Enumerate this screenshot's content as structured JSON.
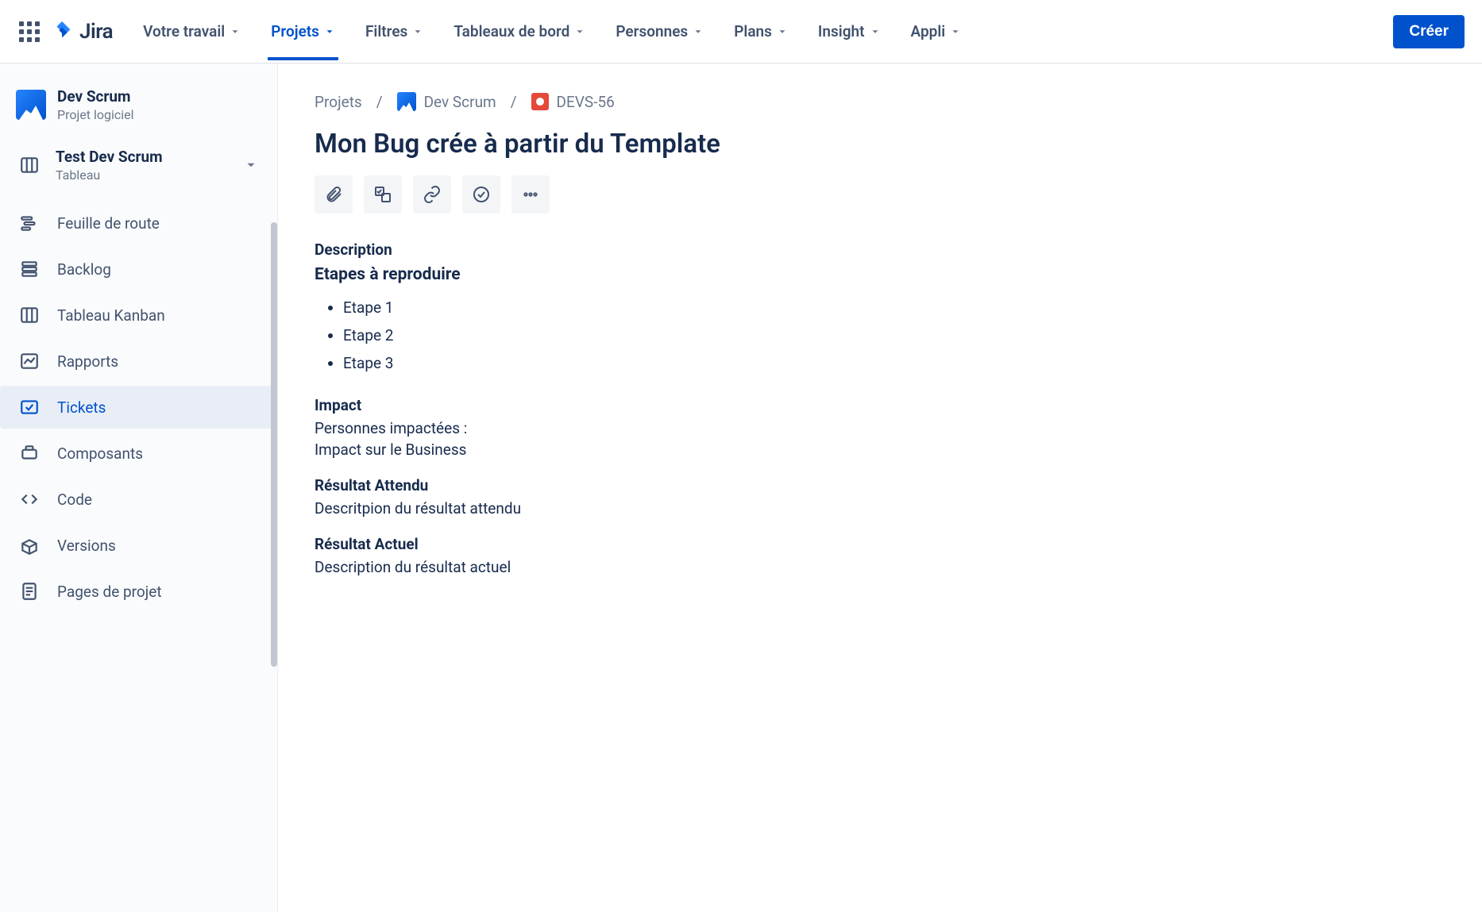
{
  "topnav": {
    "product": "Jira",
    "items": [
      {
        "label": "Votre travail",
        "active": false
      },
      {
        "label": "Projets",
        "active": true
      },
      {
        "label": "Filtres",
        "active": false
      },
      {
        "label": "Tableaux de bord",
        "active": false
      },
      {
        "label": "Personnes",
        "active": false
      },
      {
        "label": "Plans",
        "active": false
      },
      {
        "label": "Insight",
        "active": false
      },
      {
        "label": "Appli",
        "active": false
      }
    ],
    "create": "Créer"
  },
  "sidebar": {
    "project": {
      "name": "Dev Scrum",
      "type": "Projet logiciel"
    },
    "board": {
      "title": "Test Dev Scrum",
      "sub": "Tableau"
    },
    "items": [
      {
        "label": "Feuille de route",
        "icon": "roadmap"
      },
      {
        "label": "Backlog",
        "icon": "backlog"
      },
      {
        "label": "Tableau Kanban",
        "icon": "board"
      },
      {
        "label": "Rapports",
        "icon": "reports"
      },
      {
        "label": "Tickets",
        "icon": "issues",
        "selected": true
      },
      {
        "label": "Composants",
        "icon": "components"
      },
      {
        "label": "Code",
        "icon": "code"
      },
      {
        "label": "Versions",
        "icon": "versions"
      },
      {
        "label": "Pages de projet",
        "icon": "pages"
      }
    ]
  },
  "breadcrumb": {
    "root": "Projets",
    "project": "Dev Scrum",
    "issue_key": "DEVS-56"
  },
  "issue": {
    "title": "Mon Bug crée à partir du Template",
    "description_label": "Description",
    "steps_heading": "Etapes à reproduire",
    "steps": [
      "Etape 1",
      "Etape 2",
      "Etape 3"
    ],
    "impact": {
      "heading": "Impact",
      "line1": "Personnes impactées :",
      "line2": "Impact sur le Business"
    },
    "expected": {
      "heading": "Résultat Attendu",
      "body": "Descritpion du résultat attendu"
    },
    "actual": {
      "heading": "Résultat Actuel",
      "body": "Description du résultat actuel"
    }
  }
}
